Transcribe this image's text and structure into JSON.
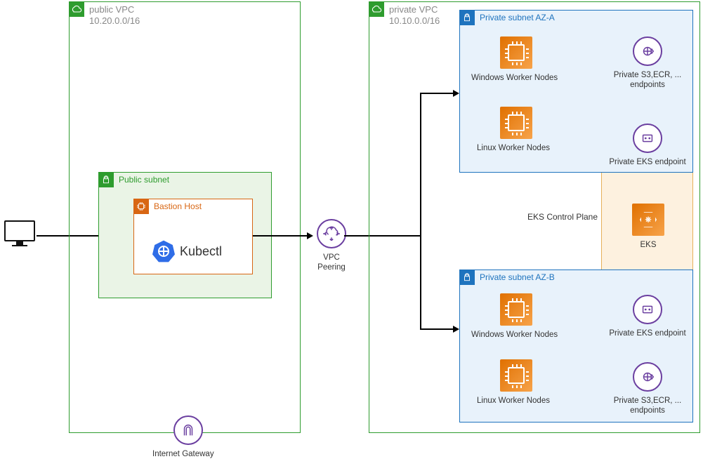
{
  "client": {
    "label": ""
  },
  "publicVPC": {
    "title": "public VPC",
    "cidr": "10.20.0.0/16",
    "publicSubnet": {
      "label": "Public subnet",
      "bastion": {
        "label": "Bastion Host",
        "tool": "Kubectl"
      }
    },
    "igw": "Internet Gateway"
  },
  "peering": {
    "label": "VPC Peering"
  },
  "privateVPC": {
    "title": "private VPC",
    "cidr": "10.10.0.0/16",
    "subnetA": {
      "label": "Private subnet AZ-A",
      "win": "Windows Worker Nodes",
      "linux": "Linux Worker Nodes",
      "s3": "Private S3,ECR, ... endpoints",
      "eksEndpoint": "Private EKS endpoint"
    },
    "controlPlane": "EKS Control Plane",
    "eks": "EKS",
    "subnetB": {
      "label": "Private subnet AZ-B",
      "win": "Windows Worker Nodes",
      "linux": "Linux Worker Nodes",
      "s3": "Private S3,ECR, ... endpoints",
      "eksEndpoint": "Private EKS endpoint"
    }
  }
}
